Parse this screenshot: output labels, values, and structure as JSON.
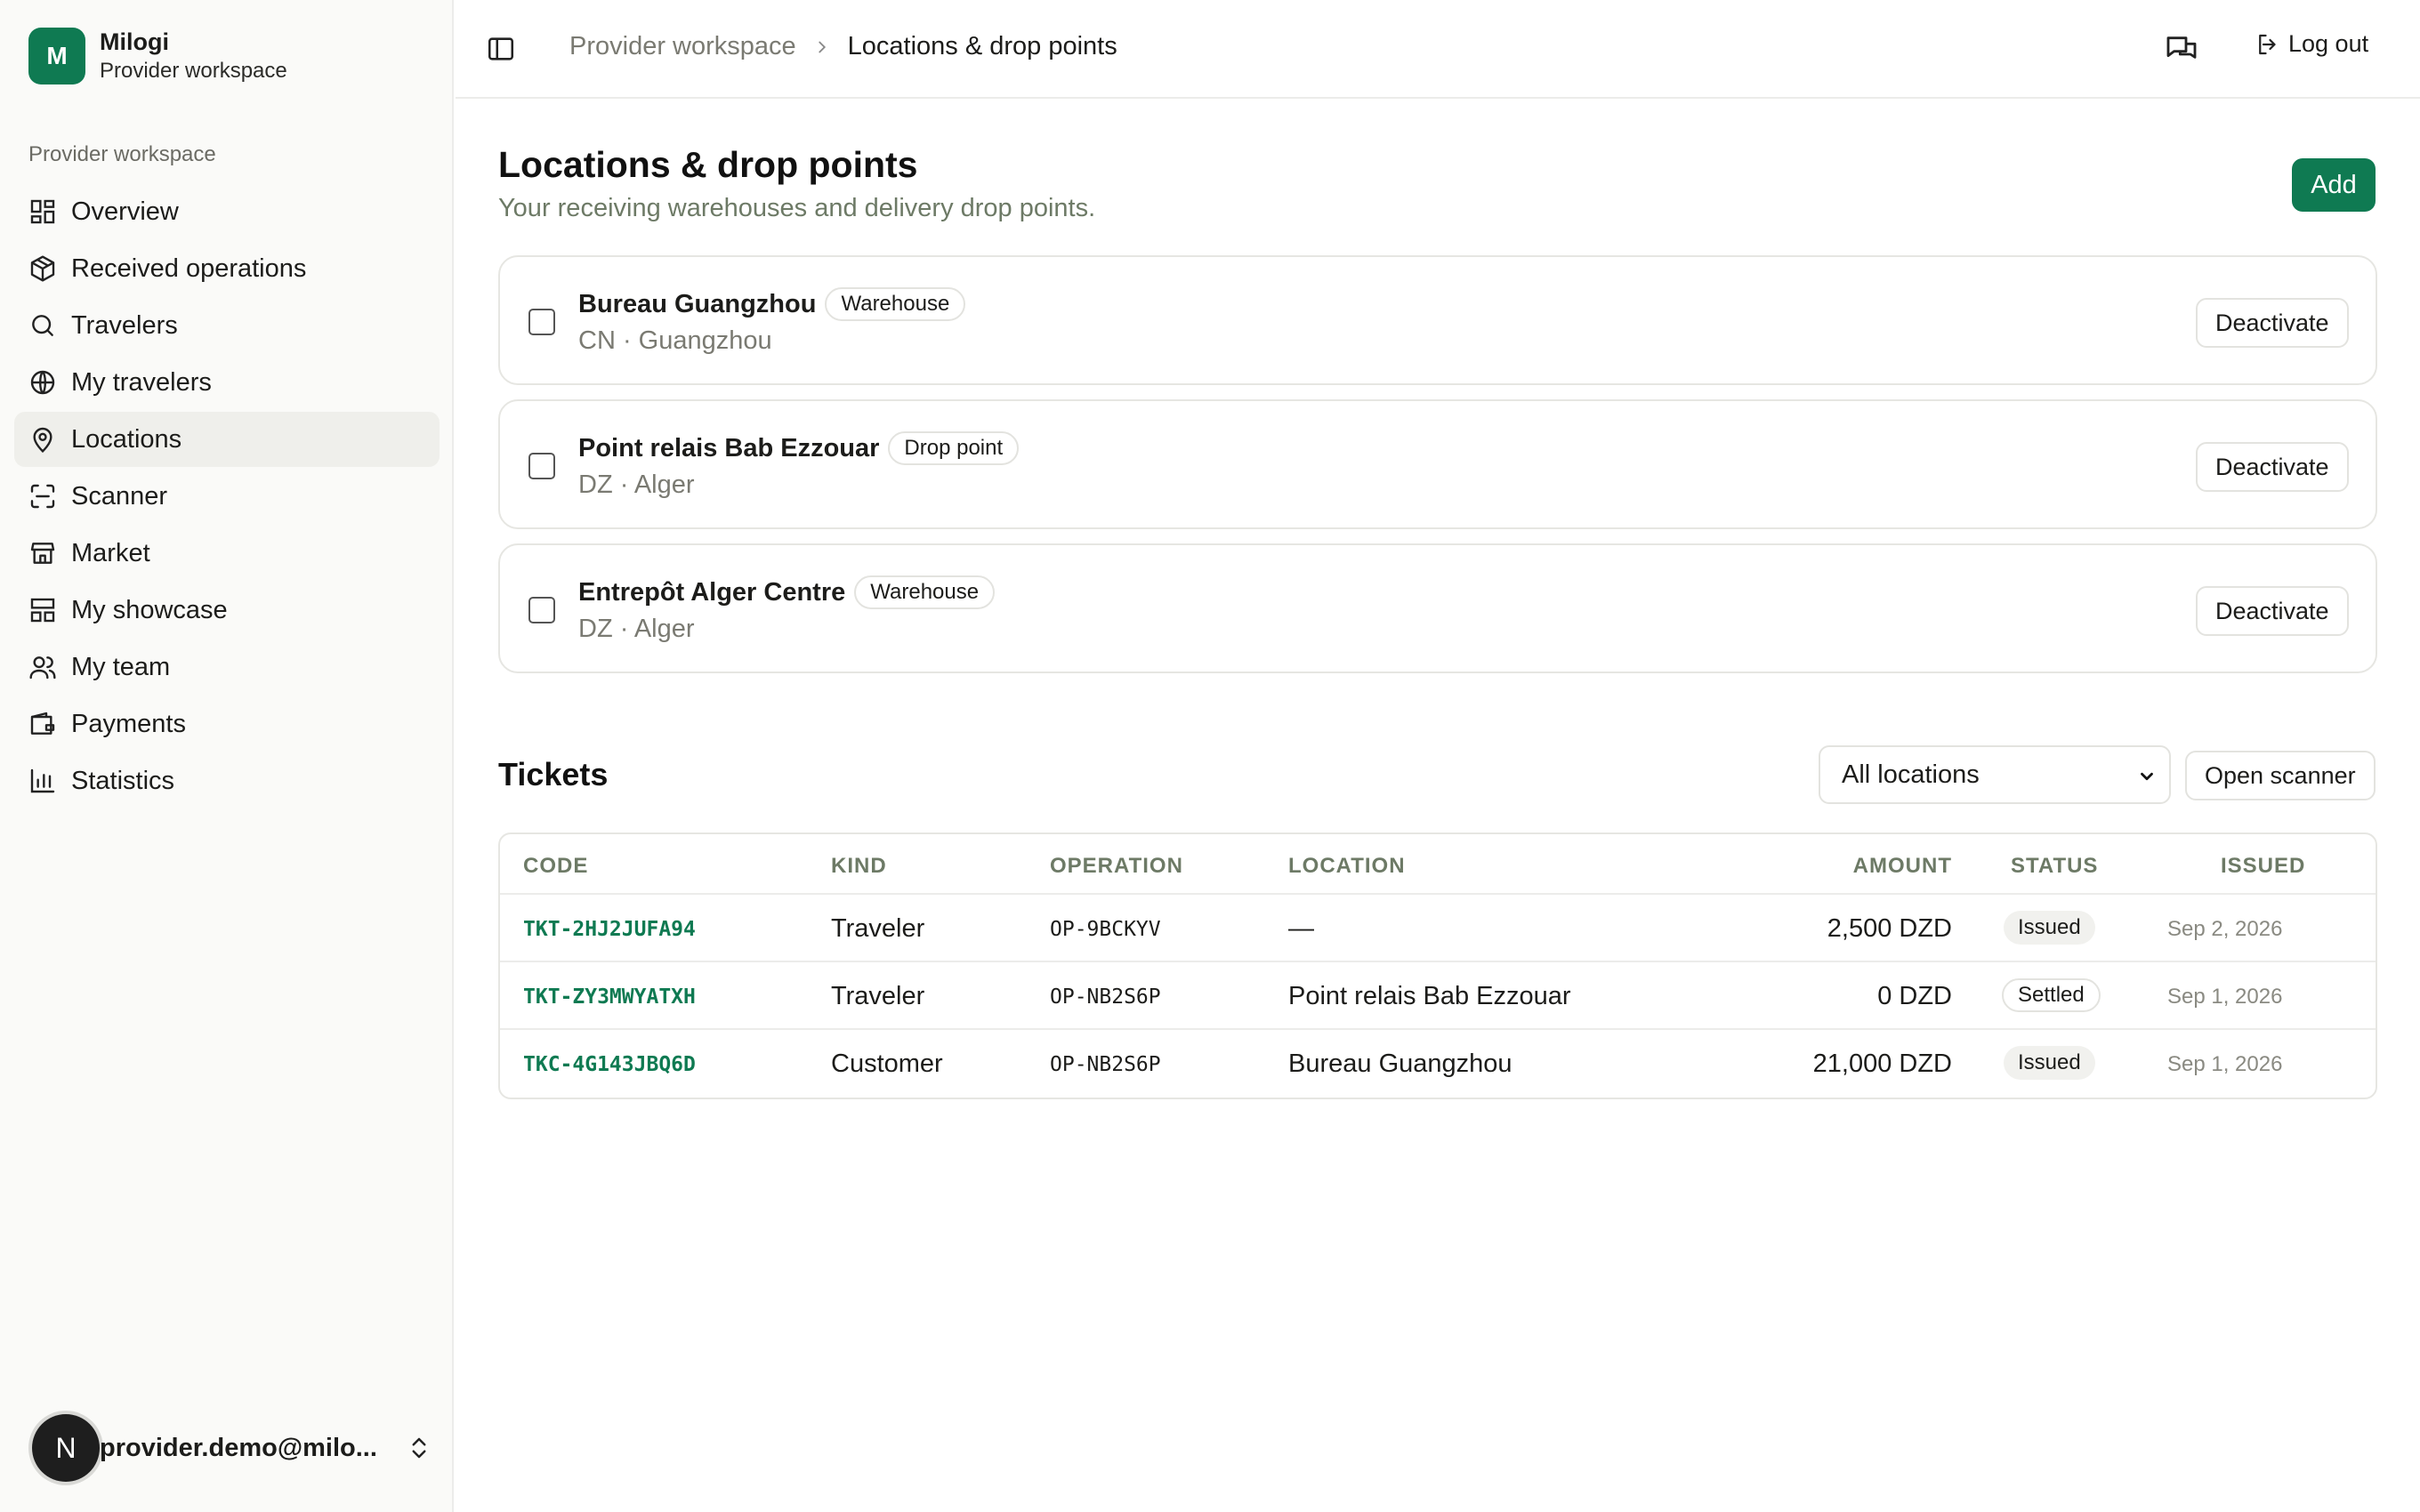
{
  "brand": {
    "logo_letter": "M",
    "name": "Milogi",
    "subtitle": "Provider workspace"
  },
  "sidebar": {
    "group_label": "Provider workspace",
    "items": [
      {
        "label": "Overview",
        "icon": "grid-icon",
        "active": false
      },
      {
        "label": "Received operations",
        "icon": "package-icon",
        "active": false
      },
      {
        "label": "Travelers",
        "icon": "search-icon",
        "active": false
      },
      {
        "label": "My travelers",
        "icon": "globe-icon",
        "active": false
      },
      {
        "label": "Locations",
        "icon": "map-pin-icon",
        "active": true
      },
      {
        "label": "Scanner",
        "icon": "scan-icon",
        "active": false
      },
      {
        "label": "Market",
        "icon": "store-icon",
        "active": false
      },
      {
        "label": "My showcase",
        "icon": "layout-icon",
        "active": false
      },
      {
        "label": "My team",
        "icon": "users-icon",
        "active": false
      },
      {
        "label": "Payments",
        "icon": "wallet-icon",
        "active": false
      },
      {
        "label": "Statistics",
        "icon": "bar-chart-icon",
        "active": false
      }
    ],
    "user": {
      "avatar_letter": "N",
      "email": "provider.demo@milo..."
    }
  },
  "topbar": {
    "breadcrumb_root": "Provider workspace",
    "breadcrumb_current": "Locations & drop points",
    "logout_label": "Log out"
  },
  "page": {
    "title": "Locations & drop points",
    "subtitle": "Your receiving warehouses and delivery drop points.",
    "add_label": "Add"
  },
  "locations": [
    {
      "name": "Bureau Guangzhou",
      "badge": "Warehouse",
      "meta": "CN · Guangzhou",
      "action": "Deactivate"
    },
    {
      "name": "Point relais Bab Ezzouar",
      "badge": "Drop point",
      "meta": "DZ · Alger",
      "action": "Deactivate"
    },
    {
      "name": "Entrepôt Alger Centre",
      "badge": "Warehouse",
      "meta": "DZ · Alger",
      "action": "Deactivate"
    }
  ],
  "tickets": {
    "title": "Tickets",
    "filter_value": "All locations",
    "scanner_label": "Open scanner",
    "columns": {
      "code": "CODE",
      "kind": "KIND",
      "operation": "OPERATION",
      "location": "LOCATION",
      "amount": "AMOUNT",
      "status": "STATUS",
      "issued": "ISSUED"
    },
    "rows": [
      {
        "code": "TKT-2HJ2JUFA94",
        "kind": "Traveler",
        "operation": "OP-9BCKYV",
        "location": "—",
        "amount": "2,500 DZD",
        "status": "Issued",
        "issued": "Sep 2, 2026"
      },
      {
        "code": "TKT-ZY3MWYATXH",
        "kind": "Traveler",
        "operation": "OP-NB2S6P",
        "location": "Point relais Bab Ezzouar",
        "amount": "0 DZD",
        "status": "Settled",
        "issued": "Sep 1, 2026"
      },
      {
        "code": "TKC-4G143JBQ6D",
        "kind": "Customer",
        "operation": "OP-NB2S6P",
        "location": "Bureau Guangzhou",
        "amount": "21,000 DZD",
        "status": "Issued",
        "issued": "Sep 1, 2026"
      }
    ]
  },
  "colors": {
    "accent": "#0f7a52",
    "muted_text": "#6d7a66",
    "border": "#e6e6e2",
    "sidebar_bg": "#fafaf8"
  }
}
